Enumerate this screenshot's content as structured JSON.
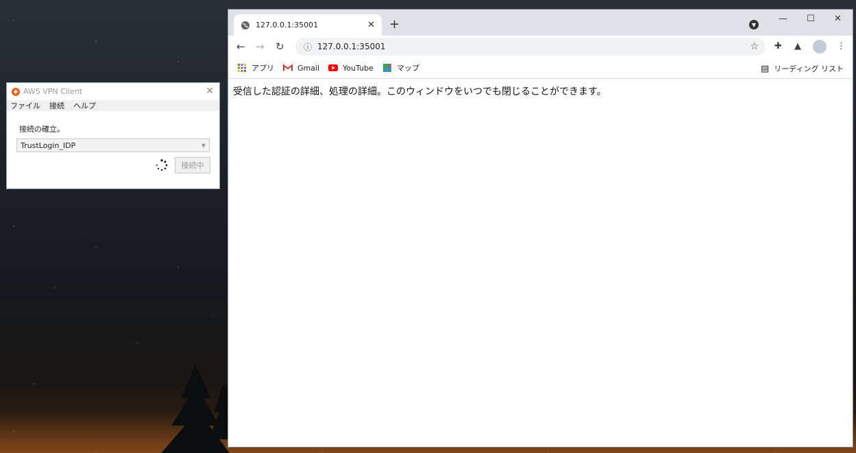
{
  "vpn": {
    "title": "AWS VPN Client",
    "menu": [
      "ファイル",
      "接続",
      "ヘルプ"
    ],
    "status_label": "接続の確立。",
    "profile_selected": "TrustLogin_IDP",
    "connect_button": "接続中"
  },
  "chrome": {
    "tab_title": "127.0.0.1:35001",
    "url": "127.0.0.1:35001",
    "bookmarks": [
      {
        "label": "アプリ",
        "icon": "apps-grid-icon"
      },
      {
        "label": "Gmail",
        "icon": "gmail-icon"
      },
      {
        "label": "YouTube",
        "icon": "youtube-icon"
      },
      {
        "label": "マップ",
        "icon": "maps-icon"
      }
    ],
    "reading_list": "リーディング リスト",
    "page_text": "受信した認証の詳細、処理の詳細。このウィンドウをいつでも閉じることができます。"
  }
}
